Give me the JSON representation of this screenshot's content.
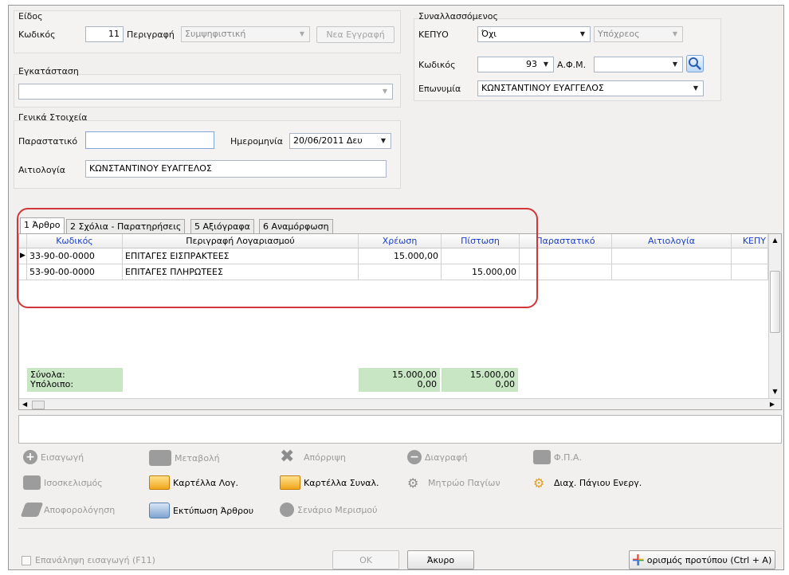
{
  "eidos": {
    "title": "Είδος",
    "code_label": "Κωδικός",
    "code_value": "11",
    "desc_label": "Περιγραφή",
    "desc_value": "Συμψηφιστική",
    "new_entry": "Νεα Εγγραφή"
  },
  "egkatastasi": {
    "title": "Εγκατάσταση",
    "value": ""
  },
  "synallassomenos": {
    "title": "Συναλλασσόμενος",
    "kepyo_label": "ΚΕΠΥΟ",
    "kepyo_value": "Όχι",
    "kepyo_type": "Υπόχρεος",
    "code_label": "Κωδικός",
    "code_value": "93",
    "afm_label": "Α.Φ.Μ.",
    "afm_value": "",
    "name_label": "Επωνυμία",
    "name_value": "ΚΩΝΣΤΑΝΤΙΝΟΥ ΕΥΑΓΓΕΛΟΣ"
  },
  "general": {
    "title": "Γενικά Στοιχεία",
    "doc_label": "Παραστατικό",
    "doc_value": "",
    "date_label": "Ημερομηνία",
    "date_value": "20/06/2011 Δευ",
    "reason_label": "Αιτιολογία",
    "reason_value": "ΚΩΝΣΤΑΝΤΙΝΟΥ ΕΥΑΓΓΕΛΟΣ"
  },
  "tabs": [
    "1 Άρθρο",
    "2 Σχόλια - Παρατηρήσεις",
    "5 Αξιόγραφα",
    "6 Αναμόρφωση"
  ],
  "grid": {
    "headers": [
      "Κωδικός",
      "Περιγραφή Λογαριασμού",
      "Χρέωση",
      "Πίστωση",
      "Παραστατικό",
      "Αιτιολογία",
      "ΚΕΠΥ"
    ],
    "rows": [
      {
        "code": "33-90-00-0000",
        "desc": "ΕΠΙΤΑΓΕΣ ΕΙΣΠΡΑΚΤΕΕΣ",
        "debit": "15.000,00",
        "credit": ""
      },
      {
        "code": "53-90-00-0000",
        "desc": "ΕΠΙΤΑΓΕΣ ΠΛΗΡΩΤΕΕΣ",
        "debit": "",
        "credit": "15.000,00"
      }
    ],
    "totals_label": "Σύνολα:",
    "balance_label": "Υπόλοιπο:",
    "total_debit": "15.000,00",
    "total_credit": "15.000,00",
    "balance_debit": "0,00",
    "balance_credit": "0,00"
  },
  "toolbar": {
    "insert": "Εισαγωγή",
    "modify": "Μεταβολή",
    "reject": "Απόρριψη",
    "delete": "Διαγραφή",
    "vat": "Φ.Π.Α.",
    "balance": "Ισοσκελισμός",
    "account_card": "Καρτέλλα Λογ.",
    "partner_card": "Καρτέλλα Συναλ.",
    "fixed_assets": "Μητρώο Παγίων",
    "asset_mgmt": "Διαχ. Πάγιου Ενεργ.",
    "depreciation": "Αποφορολόγηση",
    "print": "Εκτύπωση Άρθρου",
    "allocation": "Σενάριο Μερισμού"
  },
  "footer": {
    "repeat_label": "Επανάληψη εισαγωγή (F11)",
    "ok": "ΟΚ",
    "cancel": "Άκυρο",
    "template": "ορισμός προτύπου (Ctrl + A)"
  },
  "colors": {
    "highlight": "#d1373a",
    "totals_bg": "#c8e6c4",
    "header_blue": "#1a3fd0"
  }
}
